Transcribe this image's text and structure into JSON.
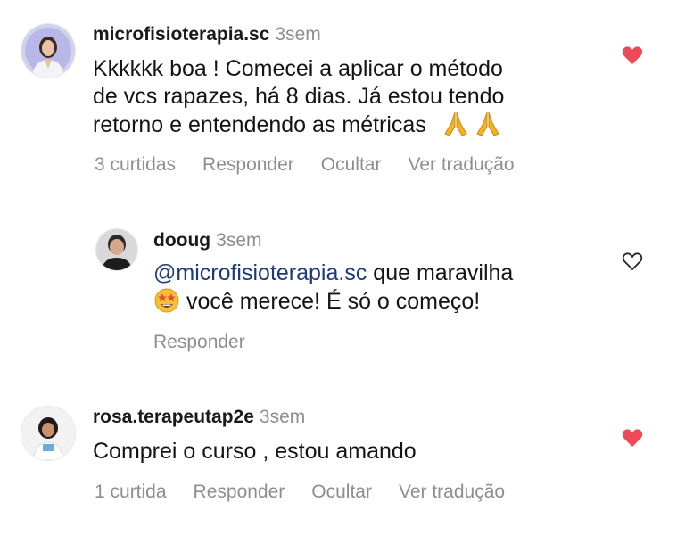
{
  "comments": [
    {
      "username": "microfisioterapia.sc",
      "time": "3sem",
      "lines": [
        "Kkkkkk boa ! Comecei a aplicar o método",
        "de vcs rapazes, há 8 dias. Já estou tendo",
        "retorno e entendendo as métricas"
      ],
      "emojis": [
        "folded-hands",
        "folded-hands"
      ],
      "likes": "3 curtidas",
      "reply": "Responder",
      "hide": "Ocultar",
      "translate": "Ver tradução",
      "liked": true,
      "heart_color": "#ed4956"
    },
    {
      "username": "dooug",
      "time": "3sem",
      "mention": "@microfisioterapia.sc",
      "line1_rest": " que maravilha",
      "line2": " você merece! É só o começo!",
      "emoji": "star-struck",
      "reply": "Responder",
      "liked": false
    },
    {
      "username": "rosa.terapeutap2e",
      "time": "3sem",
      "text": "Comprei o curso , estou amando",
      "likes": "1 curtida",
      "reply": "Responder",
      "hide": "Ocultar",
      "translate": "Ver tradução",
      "liked": true,
      "heart_color": "#ed4956"
    }
  ],
  "colors": {
    "muted": "#8e8e8e",
    "mention": "#1e3a78",
    "heart": "#ed4956"
  }
}
